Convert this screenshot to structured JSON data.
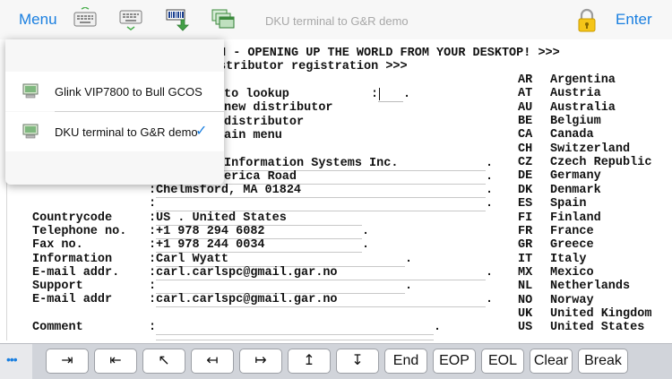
{
  "toolbar": {
    "menu_label": "Menu",
    "title": "DKU terminal to G&R demo",
    "enter_label": "Enter",
    "icons": [
      "keyboard-icon",
      "keyboard-hide-icon",
      "macro-record-icon",
      "windows-icon",
      "lock-icon"
    ]
  },
  "menu": {
    "items": [
      {
        "label": "Glink VIP7800 to Bull GCOS",
        "selected": false
      },
      {
        "label": "DKU terminal to G&R demo",
        "selected": true
      }
    ],
    "check_glyph": "✓"
  },
  "terminal": {
    "line1": "N - OPENING UP THE WORLD FROM YOUR DESKTOP! >>>",
    "line2": "stributor registration >>>",
    "line3a": "to lookup",
    "line3b": ":",
    "line4": "new distributor",
    "line5": "distributor",
    "line6": "ain menu",
    "company": "Information Systems Inc.",
    "street": "erica Road",
    "city_label": ":",
    "city": "Chelmsford, MA 01824",
    "blank_label": ":",
    "fields": [
      {
        "label": "Countrycode",
        "value": "US . United States"
      },
      {
        "label": "Telephone no.",
        "value": "+1 978 294 6082"
      },
      {
        "label": "Fax no.",
        "value": "+1 978 244 0034"
      },
      {
        "label": "Information",
        "value": "Carl Wyatt"
      },
      {
        "label": "E-mail addr.",
        "value": "carl.carlspc@gmail.gar.no"
      },
      {
        "label": "Support",
        "value": ""
      },
      {
        "label": "E-mail addr",
        "value": "carl.carlspc@gmail.gar.no"
      },
      {
        "label": "Comment",
        "value": ""
      }
    ],
    "countries": [
      {
        "code": "AR",
        "name": "Argentina"
      },
      {
        "code": "AT",
        "name": "Austria"
      },
      {
        "code": "AU",
        "name": "Australia"
      },
      {
        "code": "BE",
        "name": "Belgium"
      },
      {
        "code": "CA",
        "name": "Canada"
      },
      {
        "code": "CH",
        "name": "Switzerland"
      },
      {
        "code": "CZ",
        "name": "Czech Republic"
      },
      {
        "code": "DE",
        "name": "Germany"
      },
      {
        "code": "DK",
        "name": "Denmark"
      },
      {
        "code": "ES",
        "name": "Spain"
      },
      {
        "code": "FI",
        "name": "Finland"
      },
      {
        "code": "FR",
        "name": "France"
      },
      {
        "code": "GR",
        "name": "Greece"
      },
      {
        "code": "IT",
        "name": "Italy"
      },
      {
        "code": "MX",
        "name": "Mexico"
      },
      {
        "code": "NL",
        "name": "Netherlands"
      },
      {
        "code": "NO",
        "name": "Norway"
      },
      {
        "code": "UK",
        "name": "United Kingdom"
      },
      {
        "code": "US",
        "name": "United States"
      }
    ]
  },
  "keybar": {
    "more_label": "•••",
    "keys": [
      {
        "name": "tab-forward-key",
        "label": "⇥"
      },
      {
        "name": "tab-back-key",
        "label": "⇤"
      },
      {
        "name": "home-key",
        "label": "↖"
      },
      {
        "name": "left-key",
        "label": "↤"
      },
      {
        "name": "right-key",
        "label": "↦"
      },
      {
        "name": "up-key",
        "label": "↥"
      },
      {
        "name": "down-key",
        "label": "↧"
      },
      {
        "name": "end-key",
        "label": "End"
      },
      {
        "name": "eop-key",
        "label": "EOP"
      },
      {
        "name": "eol-key",
        "label": "EOL"
      },
      {
        "name": "clear-key",
        "label": "Clear"
      },
      {
        "name": "break-key",
        "label": "Break"
      }
    ]
  }
}
